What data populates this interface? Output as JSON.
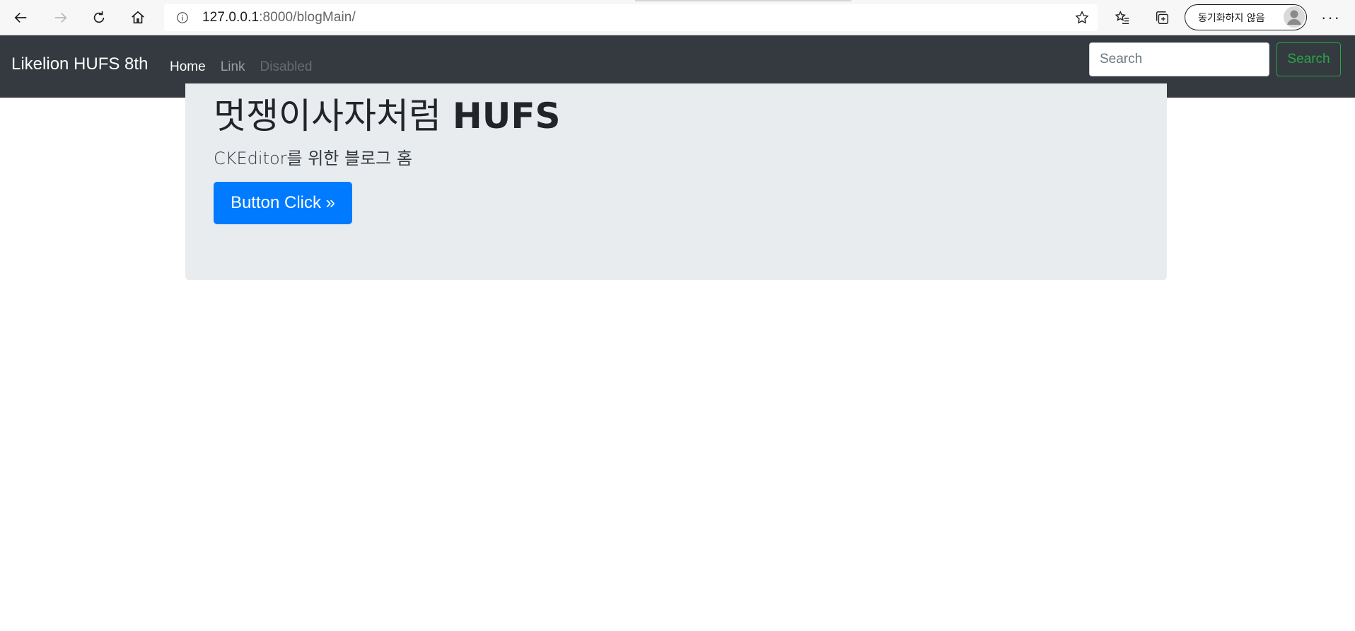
{
  "browser": {
    "url_host": "127.0.0.1",
    "url_rest": ":8000/blogMain/",
    "sync_label": "동기화하지 않음",
    "more_label": "···",
    "icons": {
      "back": "back-arrow-icon",
      "forward": "forward-arrow-icon",
      "refresh": "refresh-icon",
      "home": "home-icon",
      "info": "info-icon",
      "favorite": "star-icon",
      "favorites": "favorites-list-icon",
      "collections": "collections-icon",
      "avatar": "profile-avatar-icon"
    }
  },
  "navbar": {
    "brand": "Likelion HUFS 8th",
    "links": [
      {
        "label": "Home",
        "state": "active"
      },
      {
        "label": "Link",
        "state": "normal"
      },
      {
        "label": "Disabled",
        "state": "disabled"
      }
    ],
    "search_placeholder": "Search",
    "search_button": "Search",
    "colors": {
      "background": "#343a40",
      "search_button": "#28a745"
    }
  },
  "jumbotron": {
    "title_light": "멋쟁이사자처럼 ",
    "title_bold": "HUFS",
    "lead": "CKEditor를 위한 블로그 홈",
    "button_label": "Button Click »",
    "colors": {
      "background": "#e9ecef",
      "button": "#007bff"
    }
  }
}
